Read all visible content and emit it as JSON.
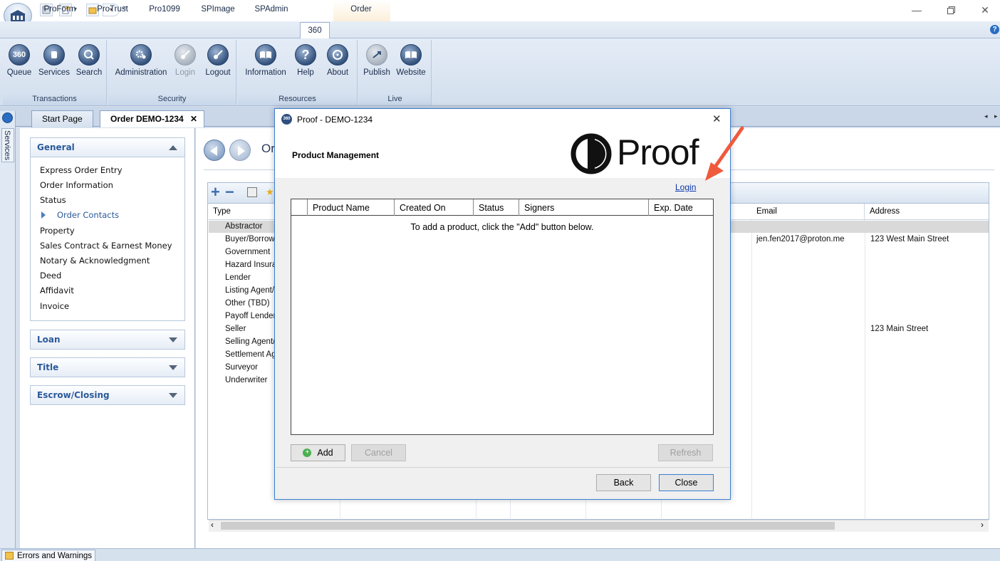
{
  "quick_access": [
    "save-icon",
    "new-icon",
    "folder-icon"
  ],
  "ribbon": {
    "tabs": [
      "ProForm",
      "ProTrust",
      "Pro1099",
      "SPImage",
      "SPAdmin",
      "360",
      "Order"
    ],
    "active_tab": "360",
    "groups": {
      "transactions": {
        "label": "Transactions",
        "buttons": {
          "queue": "Queue",
          "services": "Services",
          "search": "Search"
        }
      },
      "security": {
        "label": "Security",
        "buttons": {
          "administration": "Administration",
          "login": "Login",
          "logout": "Logout"
        }
      },
      "resources": {
        "label": "Resources",
        "buttons": {
          "information": "Information",
          "help": "Help",
          "about": "About"
        }
      },
      "live": {
        "label": "Live",
        "buttons": {
          "publish": "Publish",
          "website": "Website"
        }
      }
    },
    "queue_icon_text": "360",
    "help_icon_text": "?"
  },
  "services_strip_label": "Services",
  "doc_tabs": {
    "start": "Start Page",
    "order": "Order DEMO-1234",
    "close": "✕"
  },
  "left_panel": {
    "general": {
      "title": "General",
      "items": [
        "Express Order Entry",
        "Order Information",
        "Status",
        "Order Contacts",
        "Property",
        "Sales Contract & Earnest Money",
        "Notary & Acknowledgment",
        "Deed",
        "Affidavit",
        "Invoice"
      ]
    },
    "sections": [
      "Loan",
      "Title",
      "Escrow/Closing"
    ]
  },
  "main": {
    "heading_partial": "Or",
    "columns": {
      "type": "Type",
      "email": "Email",
      "address": "Address"
    },
    "types": [
      "Abstractor",
      "Buyer/Borrow",
      "Government",
      "Hazard Insura",
      "Lender",
      "Listing Agent/",
      "Other (TBD)",
      "Payoff Lender",
      "Seller",
      "Selling Agent/",
      "Settlement Ag",
      "Surveyor",
      "Underwriter"
    ],
    "buyer_email": "jen.fen2017@proton.me",
    "buyer_address": "123 West Main Street",
    "seller_address": "123 Main Street"
  },
  "dialog": {
    "title": "Proof - DEMO-1234",
    "icon_text": "360",
    "close": "✕",
    "heading": "Product Management",
    "brand": "Proof",
    "login_link": "Login",
    "columns": [
      "Product Name",
      "Created On",
      "Status",
      "Signers",
      "Exp. Date"
    ],
    "empty_message": "To add a product, click the \"Add\" button below.",
    "buttons": {
      "add": "Add",
      "cancel": "Cancel",
      "refresh": "Refresh",
      "back": "Back",
      "close": "Close"
    }
  },
  "statusbar": {
    "errors": "Errors and Warnings"
  },
  "colors": {
    "accent": "#2b5a9a",
    "annotation_arrow": "#ef5a3c",
    "dialog_border": "#3b7fd1"
  }
}
